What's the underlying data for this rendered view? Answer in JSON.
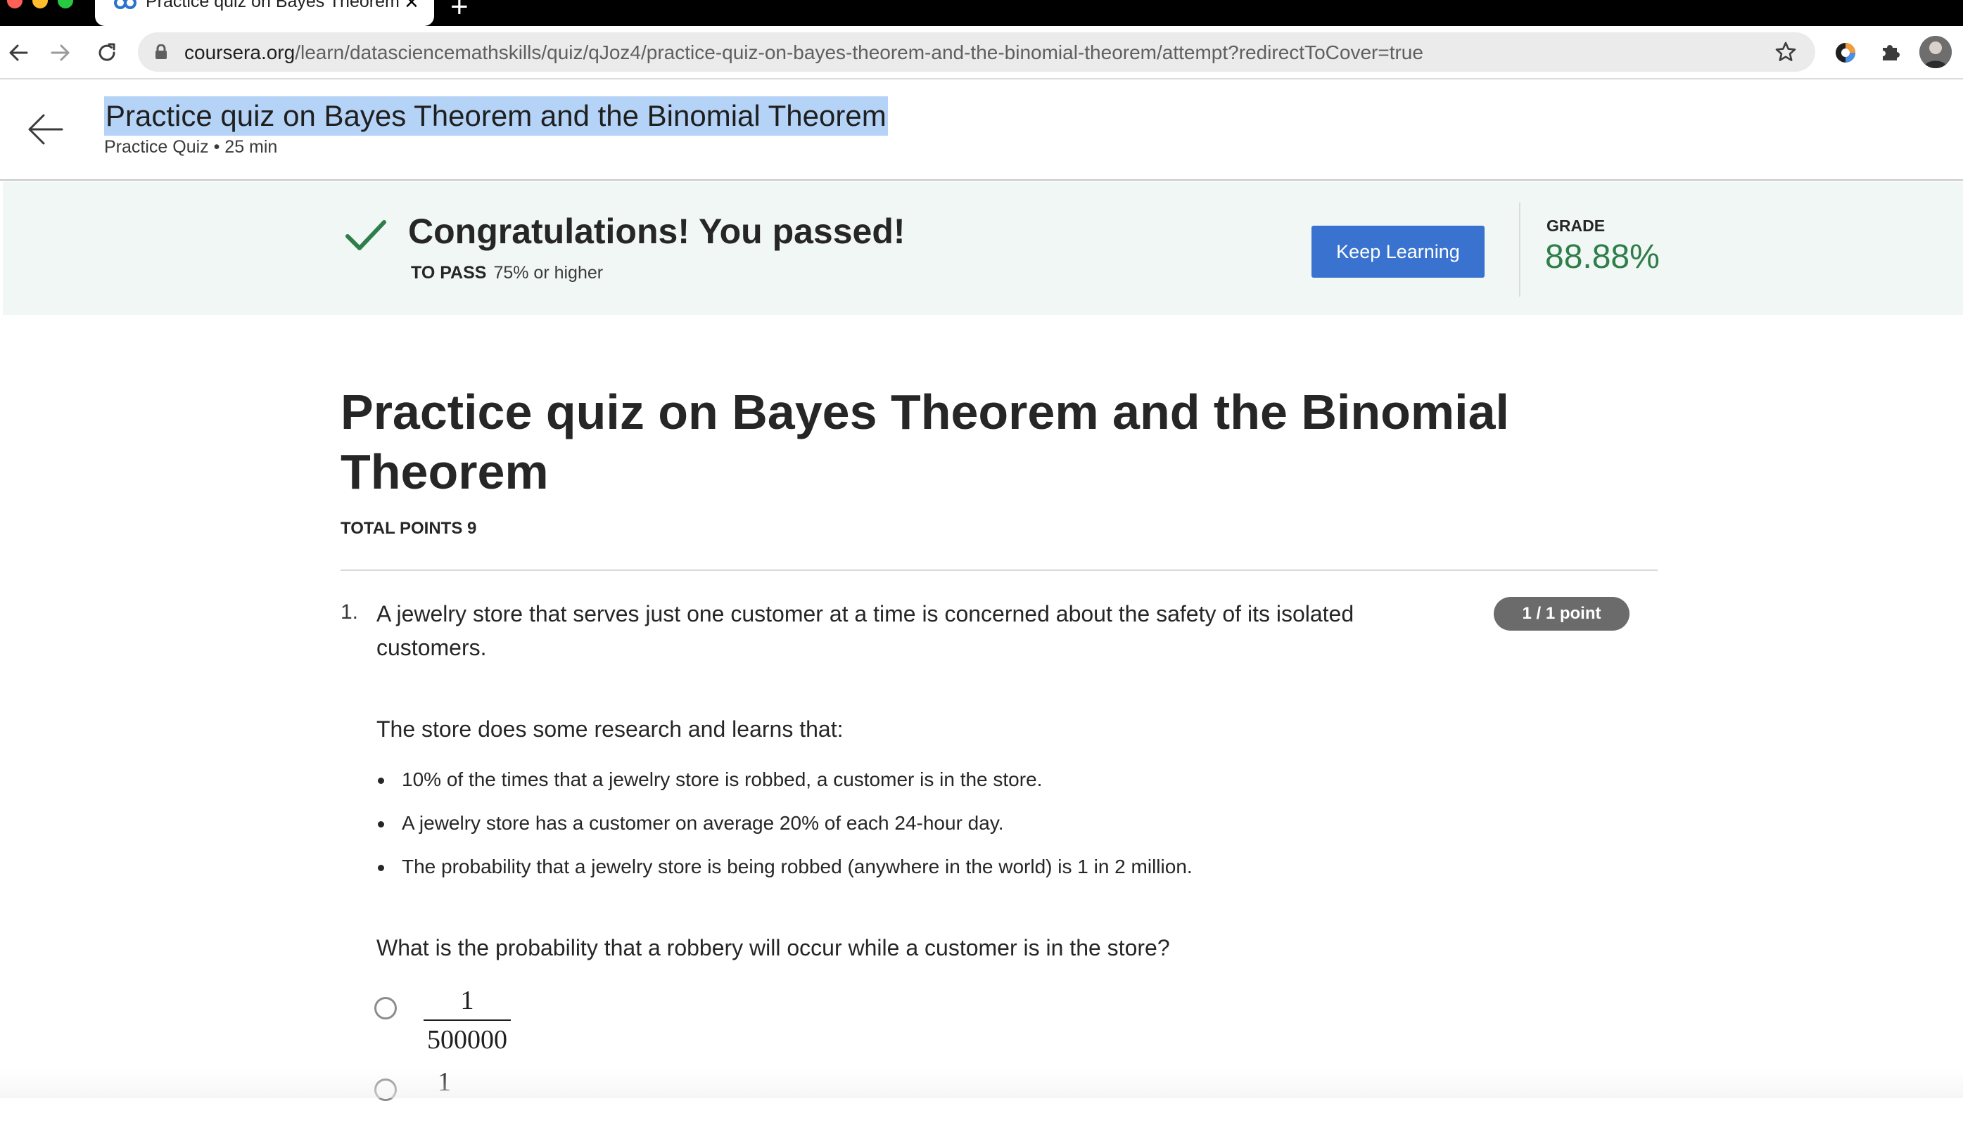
{
  "browser": {
    "tab_title": "Practice quiz on Bayes Theorem",
    "new_tab_symbol": "+",
    "url_host": "coursera.org",
    "url_path": "/learn/datasciencemathskills/quiz/qJoz4/practice-quiz-on-bayes-theorem-and-the-binomial-theorem/attempt?redirectToCover=true"
  },
  "header": {
    "title": "Practice quiz on Bayes Theorem and the Binomial Theorem",
    "meta": "Practice Quiz • 25 min"
  },
  "banner": {
    "message": "Congratulations! You passed!",
    "to_pass_label": "TO PASS",
    "to_pass_value": "75% or higher",
    "keep_learning_label": "Keep Learning",
    "grade_label": "GRADE",
    "grade_value": "88.88%"
  },
  "quiz": {
    "title": "Practice quiz on Bayes Theorem and the Binomial Theorem",
    "total_points": "TOTAL POINTS 9",
    "question1": {
      "number": "1.",
      "text": "A jewelry store that serves just one customer at a time is concerned about the safety of its isolated customers.",
      "points": "1 / 1 point",
      "lead": "The store does some research and learns that:",
      "bullets": [
        "10% of the times that a jewelry store is robbed, a customer is in the store.",
        "A jewelry store has a customer on average 20% of each 24-hour day.",
        "The probability that a jewelry store is being robbed (anywhere in the world) is 1 in 2 million."
      ],
      "ask": "What is the probability that a robbery will occur while a customer is in the store?",
      "options": [
        {
          "numerator": "1",
          "denominator": "500000"
        },
        {
          "numerator": "1",
          "denominator": ""
        }
      ]
    }
  },
  "colors": {
    "banner_bg": "#f1f7f4",
    "primary_button": "#3a73cf",
    "grade_green": "#2e7d4a",
    "selection": "#b4d3f7",
    "badge_gray": "#6b6b6b"
  }
}
